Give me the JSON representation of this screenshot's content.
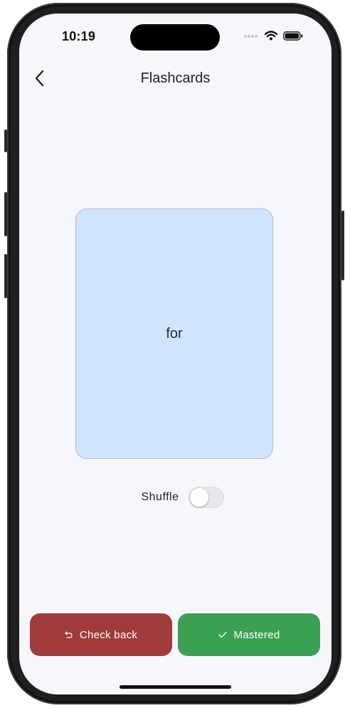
{
  "status": {
    "time": "10:19"
  },
  "nav": {
    "title": "Flashcards"
  },
  "card": {
    "text": "for"
  },
  "shuffle": {
    "label": "Shuffle",
    "on": false
  },
  "actions": {
    "check_back": {
      "label": "Check back",
      "color": "#a13b3b"
    },
    "mastered": {
      "label": "Mastered",
      "color": "#3ba053"
    }
  },
  "colors": {
    "card": "#d1e3fd",
    "background": "#f6f7fc"
  },
  "icons": [
    "chevron-left-icon",
    "undo-icon",
    "check-icon",
    "wifi-icon",
    "battery-icon",
    "signal-icon"
  ]
}
